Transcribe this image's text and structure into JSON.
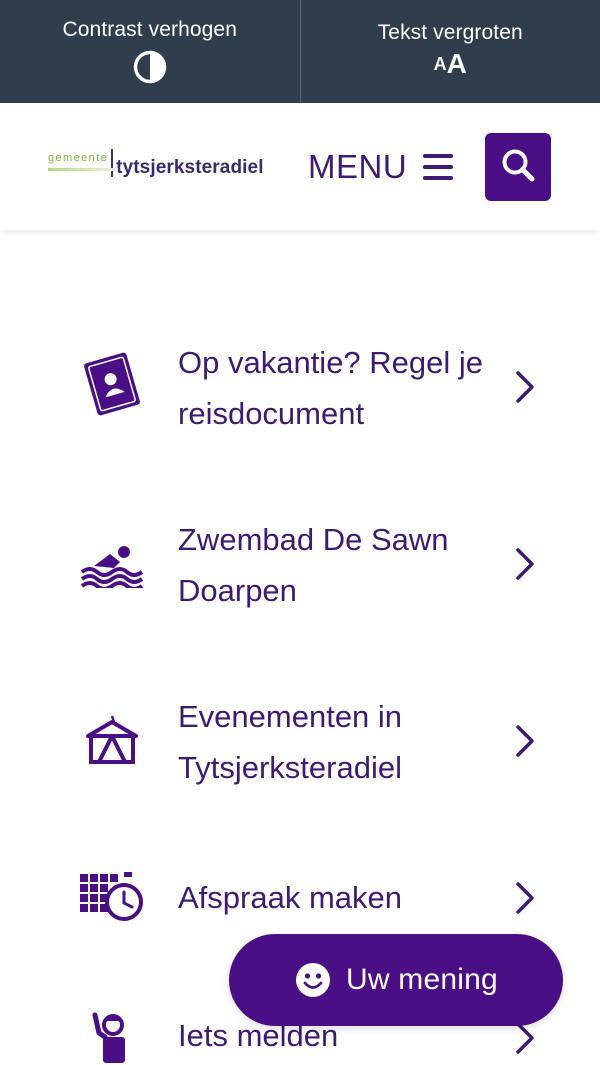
{
  "accessibility": {
    "contrast_label": "Contrast verhogen",
    "textsize_label": "Tekst vergroten",
    "textsize_icon_small": "A",
    "textsize_icon_big": "A"
  },
  "header": {
    "logo_small": "gemeente",
    "logo_big": "tytsjerksteradiel",
    "menu_label": "MENU"
  },
  "items": [
    {
      "label": "Op vakantie? Regel je reisdocument",
      "icon": "passport-icon"
    },
    {
      "label": "Zwembad De Sawn Doarpen",
      "icon": "swimmer-icon"
    },
    {
      "label": "Evenementen in Tytsjerksteradiel",
      "icon": "tent-icon"
    },
    {
      "label": "Afspraak maken",
      "icon": "calendar-clock-icon"
    },
    {
      "label": "Iets melden",
      "icon": "person-report-icon"
    }
  ],
  "feedback": {
    "label": "Uw mening",
    "icon": "smiley-icon"
  },
  "colors": {
    "accent": "#4a0f84",
    "text_purple": "#3e1a73",
    "topbar": "#2f3d4c"
  }
}
